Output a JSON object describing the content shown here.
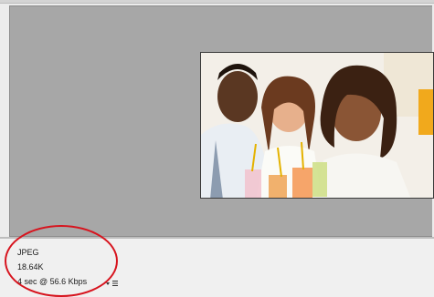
{
  "preview": {
    "image_description_icon": "photo-three-friends-drinks"
  },
  "file_info": {
    "format": "JPEG",
    "size": "18.64K",
    "download_time": "4 sec @ 56.6 Kbps"
  },
  "colors": {
    "canvas_gray": "#a7a7a7",
    "panel_bg": "#f0f0f0",
    "annotation_red": "#d7141e"
  }
}
